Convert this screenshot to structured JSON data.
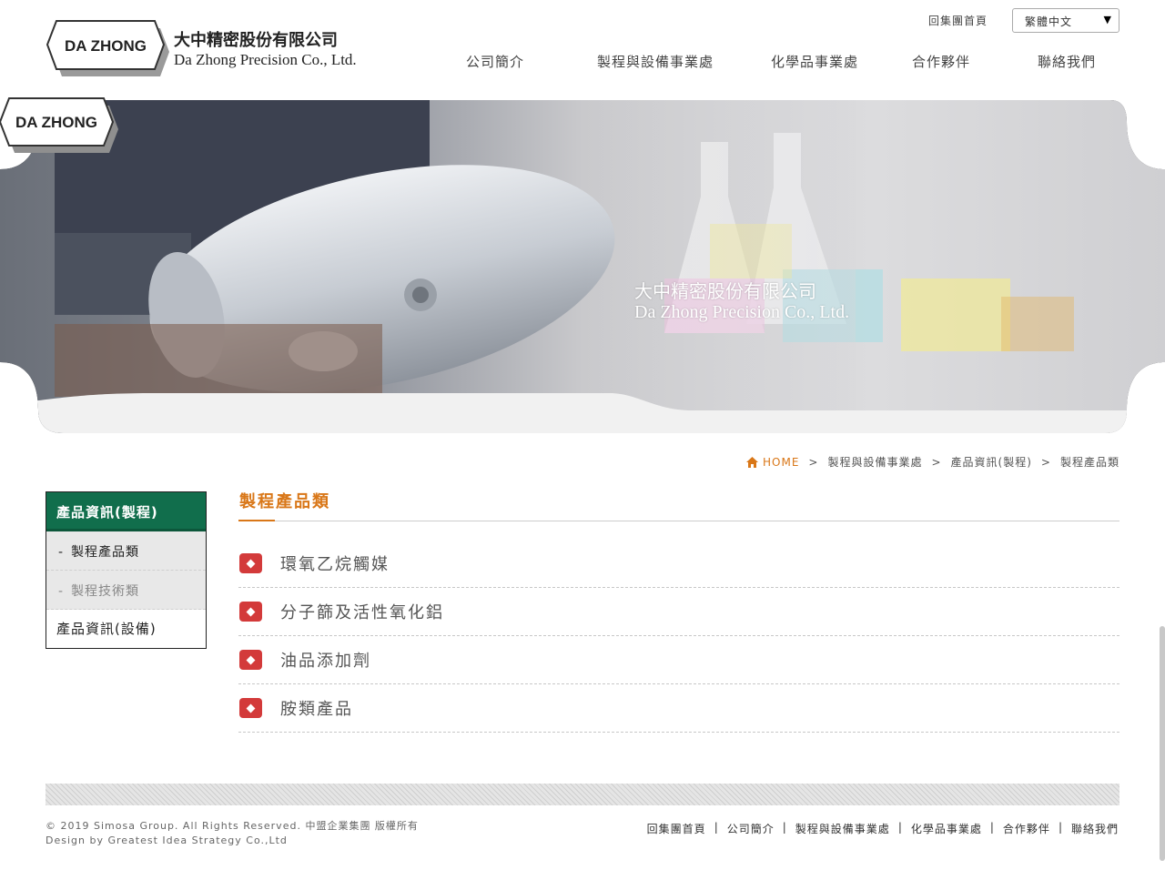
{
  "header": {
    "logo_mark": "DA ZHONG",
    "company_cn": "大中精密股份有限公司",
    "company_en": "Da Zhong Precision Co., Ltd.",
    "group_home_link": "回集團首頁",
    "language_select": {
      "selected": "繁體中文",
      "arrow": "▼"
    },
    "nav": [
      {
        "label": "公司簡介"
      },
      {
        "label": "製程與設備事業處"
      },
      {
        "label": "化學品事業處"
      },
      {
        "label": "合作夥伴"
      },
      {
        "label": "聯絡我們"
      }
    ]
  },
  "banner": {
    "logo_mark": "DA ZHONG",
    "company_cn": "大中精密股份有限公司",
    "company_en": "Da Zhong Precision Co., Ltd."
  },
  "breadcrumb": {
    "home": "HOME",
    "sep": ">",
    "items": [
      "製程與設備事業處",
      "產品資訊(製程)",
      "製程產品類"
    ]
  },
  "sidebar": {
    "heading": "產品資訊(製程)",
    "dash": "-",
    "sub_items": [
      {
        "label": "製程產品類"
      },
      {
        "label": "製程技術類"
      }
    ],
    "other_item": "產品資訊(設備)"
  },
  "content": {
    "title": "製程產品類",
    "items": [
      {
        "label": "環氧乙烷觸媒"
      },
      {
        "label": "分子篩及活性氧化鋁"
      },
      {
        "label": "油品添加劑"
      },
      {
        "label": "胺類產品"
      }
    ]
  },
  "footer": {
    "copyright_line1": "© 2019 Simosa Group. All Rights Reserved. 中盟企業集團 版權所有",
    "copyright_line2": "Design by Greatest Idea Strategy Co.,Ltd",
    "sep": "|",
    "nav": [
      "回集團首頁",
      "公司簡介",
      "製程與設備事業處",
      "化學品事業處",
      "合作夥伴",
      "聯絡我們"
    ]
  },
  "colors": {
    "accent_orange": "#d97718",
    "sidebar_green": "#116e4c",
    "bullet_red": "#d33a3a"
  }
}
